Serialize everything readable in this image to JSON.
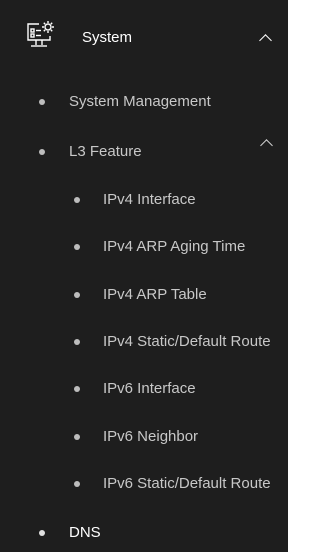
{
  "menu": {
    "title": "System",
    "title_icon": "monitor-gear-icon",
    "expand_icon": "chevron-up-icon"
  },
  "items": [
    {
      "label": "System Management"
    },
    {
      "label": "L3 Feature",
      "expand_icon": "chevron-up-icon"
    },
    {
      "label": "IPv4 Interface"
    },
    {
      "label": "IPv4 ARP Aging Time"
    },
    {
      "label": "IPv4 ARP Table"
    },
    {
      "label": "IPv4 Static/Default Route"
    },
    {
      "label": "IPv6 Interface"
    },
    {
      "label": "IPv6 Neighbor"
    },
    {
      "label": "IPv6 Static/Default Route"
    },
    {
      "label": "DNS"
    }
  ],
  "colors": {
    "background": "#1e1e1e",
    "text": "#c8c8c8",
    "text_bright": "#ffffff",
    "bullet": "#bdbdbd"
  }
}
